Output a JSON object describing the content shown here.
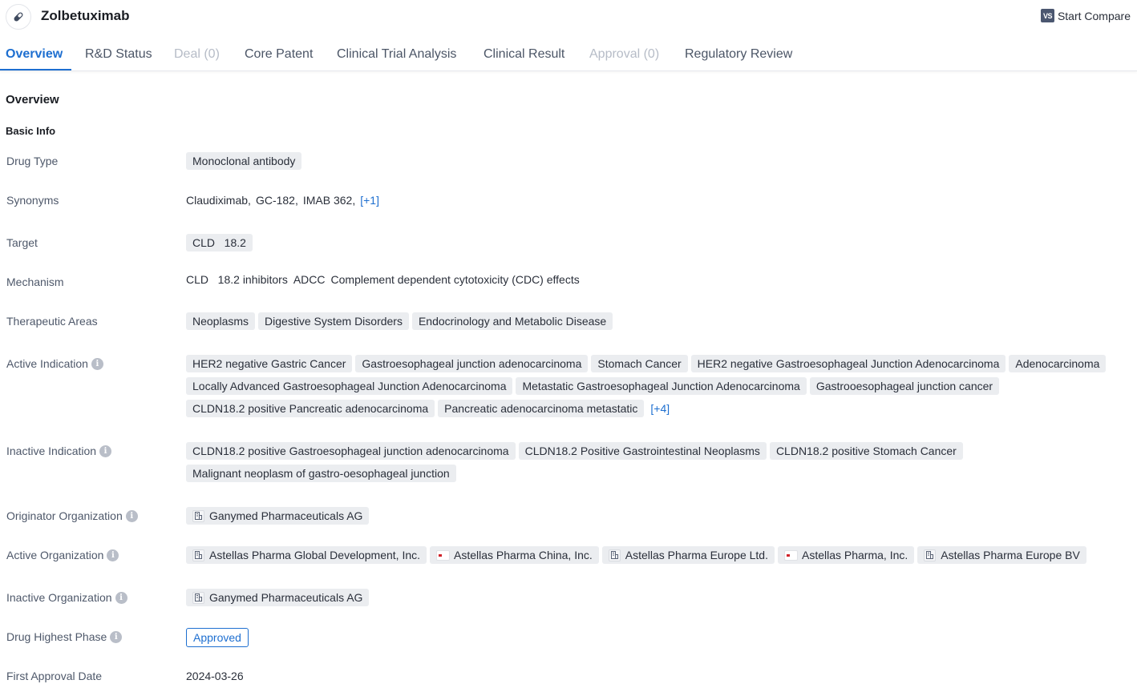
{
  "header": {
    "title": "Zolbetuximab",
    "icon": "pill-icon",
    "compare_button": {
      "icon": "vs-icon",
      "icon_text": "VS",
      "label": "Start Compare"
    }
  },
  "tabs": [
    {
      "label": "Overview",
      "state": "active"
    },
    {
      "label": "R&D Status",
      "state": "normal"
    },
    {
      "label": "Deal (0)",
      "state": "disabled"
    },
    {
      "label": "Core Patent",
      "state": "normal"
    },
    {
      "label": "Clinical Trial Analysis",
      "state": "normal"
    },
    {
      "label": "Clinical Result",
      "state": "normal"
    },
    {
      "label": "Approval (0)",
      "state": "disabled"
    },
    {
      "label": "Regulatory Review",
      "state": "normal"
    }
  ],
  "section_title": "Overview",
  "sub_title": "Basic Info",
  "fields": {
    "drug_type": {
      "label": "Drug Type",
      "values": [
        "Monoclonal antibody"
      ]
    },
    "synonyms": {
      "label": "Synonyms",
      "values": [
        "Claudiximab,",
        "GC-182,",
        "IMAB 362,"
      ],
      "more": "[+1]"
    },
    "target": {
      "label": "Target",
      "values": [
        "CLD   18.2"
      ]
    },
    "mechanism": {
      "label": "Mechanism",
      "values": [
        "CLD   18.2 inhibitors",
        "ADCC",
        "Complement dependent cytotoxicity (CDC) effects"
      ]
    },
    "therapeutic_areas": {
      "label": "Therapeutic Areas",
      "values": [
        "Neoplasms",
        "Digestive System Disorders",
        "Endocrinology and Metabolic Disease"
      ]
    },
    "active_indication": {
      "label": "Active Indication",
      "values": [
        "HER2 negative Gastric Cancer",
        "Gastroesophageal junction adenocarcinoma",
        "Stomach Cancer",
        "HER2 negative Gastroesophageal Junction Adenocarcinoma",
        "Adenocarcinoma",
        "Locally Advanced Gastroesophageal Junction Adenocarcinoma",
        "Metastatic Gastroesophageal Junction Adenocarcinoma",
        "Gastrooesophageal junction cancer",
        "CLDN18.2 positive Pancreatic adenocarcinoma",
        "Pancreatic adenocarcinoma metastatic"
      ],
      "more": "[+4]"
    },
    "inactive_indication": {
      "label": "Inactive Indication",
      "values": [
        "CLDN18.2 positive Gastroesophageal junction adenocarcinoma",
        "CLDN18.2 Positive Gastrointestinal Neoplasms",
        "CLDN18.2 positive Stomach Cancer",
        "Malignant neoplasm of gastro-oesophageal junction"
      ]
    },
    "originator_org": {
      "label": "Originator Organization",
      "values": [
        {
          "name": "Ganymed Pharmaceuticals AG",
          "icon": "building-icon"
        }
      ]
    },
    "active_org": {
      "label": "Active Organization",
      "values": [
        {
          "name": "Astellas Pharma Global Development, Inc.",
          "icon": "building-icon"
        },
        {
          "name": "Astellas Pharma China, Inc.",
          "icon": "company-logo-icon"
        },
        {
          "name": "Astellas Pharma Europe Ltd.",
          "icon": "building-icon"
        },
        {
          "name": "Astellas Pharma, Inc.",
          "icon": "company-logo-icon"
        },
        {
          "name": "Astellas Pharma Europe BV",
          "icon": "building-icon"
        }
      ]
    },
    "inactive_org": {
      "label": "Inactive Organization",
      "values": [
        {
          "name": "Ganymed Pharmaceuticals AG",
          "icon": "building-icon"
        }
      ]
    },
    "highest_phase": {
      "label": "Drug Highest Phase",
      "value": "Approved"
    },
    "first_approval_date": {
      "label": "First Approval Date",
      "value": "2024-03-26"
    }
  },
  "colors": {
    "accent": "#1e6fd0",
    "tag_bg": "#ebedf0",
    "label": "#4e586a",
    "disabled_tab": "#b6bcc7"
  }
}
